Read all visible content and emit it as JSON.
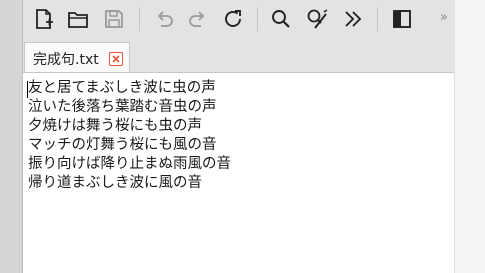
{
  "toolbar": {
    "buttons": [
      {
        "name": "new-file-icon"
      },
      {
        "name": "open-folder-icon"
      },
      {
        "name": "save-icon"
      },
      {
        "name": "undo-icon"
      },
      {
        "name": "redo-icon"
      },
      {
        "name": "reload-icon"
      },
      {
        "name": "search-icon"
      },
      {
        "name": "search-replace-icon"
      },
      {
        "name": "more-chevrons-icon"
      },
      {
        "name": "toggle-sidebar-icon"
      }
    ],
    "overflow": "»"
  },
  "tabs": [
    {
      "label": "完成句.txt",
      "active": true
    }
  ],
  "editor": {
    "lines": [
      "友と居てまぶしき波に虫の声",
      "泣いた後落ち葉踏む音虫の声",
      "夕焼けは舞う桜にも虫の声",
      "マッチの灯舞う桜にも風の音",
      "振り向けば降り止まぬ雨風の音",
      "帰り道まぶしき波に風の音"
    ]
  },
  "colors": {
    "close_accent": "#e8533a",
    "toolbar_bg": "#e3e3e3",
    "editor_bg": "#ffffff"
  }
}
